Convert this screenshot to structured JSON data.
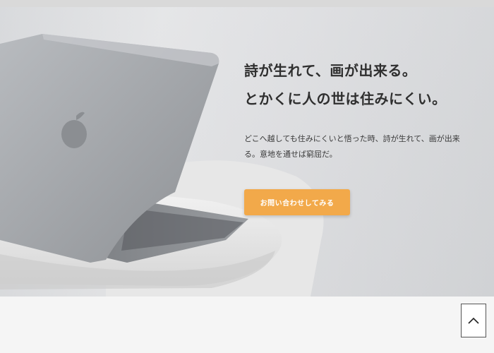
{
  "hero": {
    "headline": [
      "詩が生れて、画が出来る。",
      "とかくに人の世は住みにくい。"
    ],
    "body": "どこへ越しても住みにくいと悟った時、詩が生れて、画が出来る。意地を通せば窮屈だ。",
    "cta_label": "お問い合わせしてみる"
  },
  "icons": {
    "scroll_top": "chevron-up-icon",
    "laptop_logo": "apple-logo-icon"
  },
  "colors": {
    "cta": "#f2a94a",
    "headline": "#2f2f2f"
  }
}
